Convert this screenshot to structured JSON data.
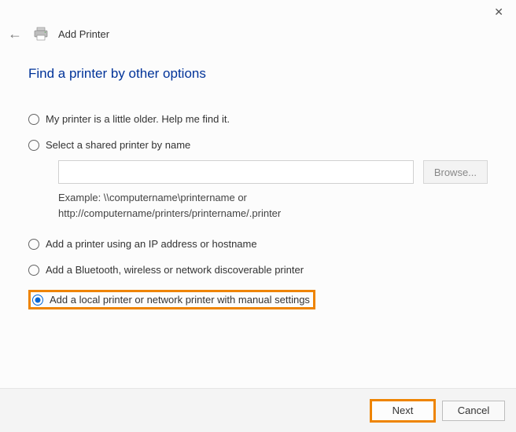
{
  "window": {
    "title": "Add Printer"
  },
  "heading": "Find a printer by other options",
  "options": {
    "older": "My printer is a little older. Help me find it.",
    "shared": "Select a shared printer by name",
    "ip": "Add a printer using an IP address or hostname",
    "bluetooth": "Add a Bluetooth, wireless or network discoverable printer",
    "local": "Add a local printer or network printer with manual settings"
  },
  "shared_input": {
    "value": "",
    "browse_label": "Browse...",
    "example": "Example: \\\\computername\\printername or http://computername/printers/printername/.printer"
  },
  "footer": {
    "next": "Next",
    "cancel": "Cancel"
  }
}
